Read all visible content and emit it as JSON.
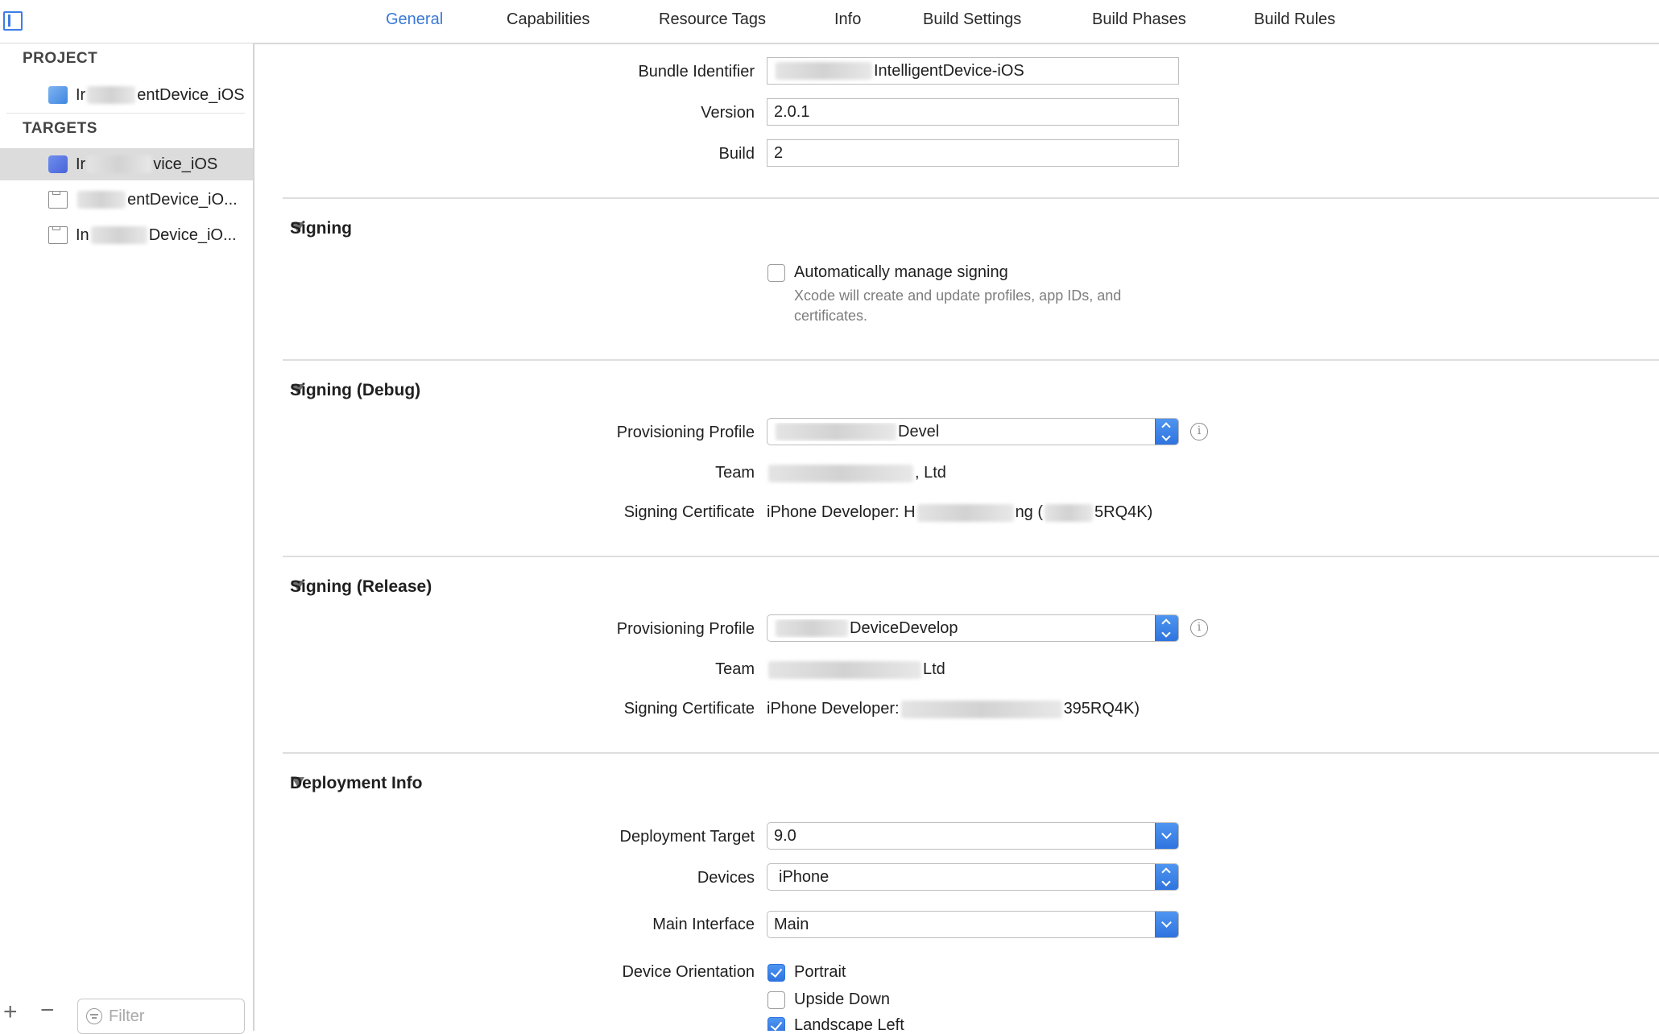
{
  "tabs": [
    "General",
    "Capabilities",
    "Resource Tags",
    "Info",
    "Build Settings",
    "Build Phases",
    "Build Rules"
  ],
  "sidebar": {
    "project_header": "PROJECT",
    "project_item": {
      "prefix": "Ir",
      "suffix": "entDevice_iOS"
    },
    "targets_header": "TARGETS",
    "targets": [
      {
        "prefix": "Ir",
        "suffix": "vice_iOS"
      },
      {
        "prefix": "",
        "suffix": "entDevice_iO..."
      },
      {
        "prefix": "In",
        "suffix": "Device_iO..."
      }
    ],
    "filter_placeholder": "Filter"
  },
  "identity": {
    "bundle_identifier_label": "Bundle Identifier",
    "bundle_identifier_value": "IntelligentDevice-iOS",
    "version_label": "Version",
    "version_value": "2.0.1",
    "build_label": "Build",
    "build_value": "2"
  },
  "signing": {
    "title": "Signing",
    "auto_label": "Automatically manage signing",
    "auto_help": "Xcode will create and update profiles, app IDs, and certificates."
  },
  "signing_debug": {
    "title": "Signing (Debug)",
    "profile_label": "Provisioning Profile",
    "profile_value": "Devel",
    "team_label": "Team",
    "team_value": ", Ltd",
    "cert_label": "Signing Certificate",
    "cert_prefix": "iPhone Developer: H",
    "cert_mid": "ng (",
    "cert_suffix": "5RQ4K)"
  },
  "signing_release": {
    "title": "Signing (Release)",
    "profile_label": "Provisioning Profile",
    "profile_value": "DeviceDevelop",
    "team_label": "Team",
    "team_value": "Ltd",
    "cert_label": "Signing Certificate",
    "cert_prefix": "iPhone Developer:",
    "cert_suffix": "395RQ4K)"
  },
  "deployment": {
    "title": "Deployment Info",
    "target_label": "Deployment Target",
    "target_value": "9.0",
    "devices_label": "Devices",
    "devices_value": "iPhone",
    "main_interface_label": "Main Interface",
    "main_interface_value": "Main",
    "orientation_label": "Device Orientation",
    "orientations": [
      "Portrait",
      "Upside Down",
      "Landscape Left"
    ]
  }
}
